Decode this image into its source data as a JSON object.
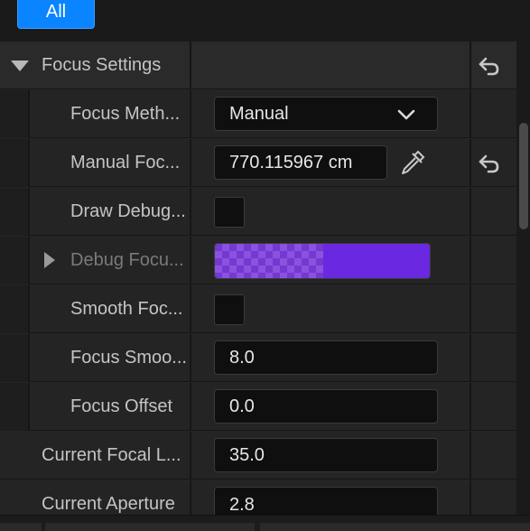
{
  "filter": {
    "all_label": "All"
  },
  "section": {
    "title": "Focus Settings"
  },
  "rows": {
    "focus_method": {
      "label": "Focus Meth...",
      "value": "Manual"
    },
    "manual_focus": {
      "label": "Manual Foc...",
      "value": "770.115967 cm"
    },
    "draw_debug": {
      "label": "Draw Debug..."
    },
    "debug_focus": {
      "label": "Debug Focu..."
    },
    "smooth_focus": {
      "label": "Smooth Foc..."
    },
    "focus_smooth": {
      "label": "Focus Smoo...",
      "value": "8.0"
    },
    "focus_offset": {
      "label": "Focus Offset",
      "value": "0.0"
    },
    "current_focal": {
      "label": "Current Focal L...",
      "value": "35.0"
    },
    "current_aperture": {
      "label": "Current Aperture",
      "value": "2.8"
    }
  },
  "icons": {
    "expand": "triangle-down-icon",
    "collapse": "triangle-right-icon",
    "reset": "reset-arrow-icon",
    "eyedropper": "eyedropper-icon",
    "chevron": "chevron-down-icon"
  },
  "colors": {
    "accent": "#0a84ff",
    "debug_color": "#6a28e0"
  }
}
